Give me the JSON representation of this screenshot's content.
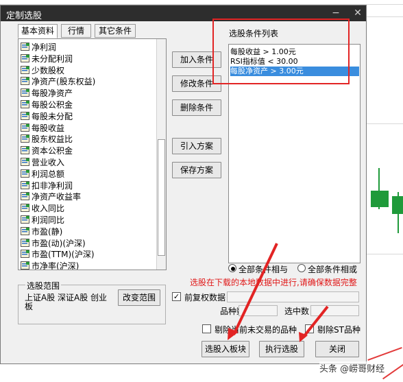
{
  "dialog": {
    "title": "定制选股",
    "tabs": [
      "基本资料",
      "行情",
      "其它条件"
    ],
    "fields": [
      "净利润",
      "未分配利润",
      "少数股权",
      "净资产(股东权益)",
      "每股净资产",
      "每股公积金",
      "每股未分配",
      "每股收益",
      "股东权益比",
      "资本公积金",
      "营业收入",
      "利润总额",
      "扣非净利润",
      "净资产收益率",
      "收入同比",
      "利润同比",
      "市盈(静)",
      "市盈(动)(沪深)",
      "市盈(TTM)(沪深)",
      "市净率(沪深)"
    ],
    "buttons": {
      "add": "加入条件",
      "modify": "修改条件",
      "delete": "删除条件",
      "import": "引入方案",
      "save": "保存方案",
      "to_block": "选股入板块",
      "execute": "执行选股",
      "close": "关闭",
      "change_range": "改变范围"
    },
    "condition_list_label": "选股条件列表",
    "conditions": [
      "每股收益 > 1.00元",
      "RSI指标值 < 30.00",
      "每股净资产 > 3.00元"
    ],
    "selected_condition_index": 2,
    "logic": {
      "and_label": "全部条件相与",
      "or_label": "全部条件相或",
      "selected": "and"
    },
    "notice": "选股在下载的本地数据中进行,请确保数据完整",
    "range": {
      "label": "选股范围",
      "value": "上证A股 深证A股 创业板"
    },
    "adjust": {
      "label": "前复权数据",
      "checked": true
    },
    "variety_count_label": "品种数",
    "selected_count_label": "选中数",
    "exclude_untraded": "剔除当前未交易的品种",
    "exclude_st": "剔除ST品种"
  },
  "watermark": "头条 @崂哥财经",
  "colors": {
    "highlight": "#3a8dde",
    "annotation_red": "#e22424",
    "notice_red": "#e01818",
    "titlebar": "#2d2d2d"
  }
}
